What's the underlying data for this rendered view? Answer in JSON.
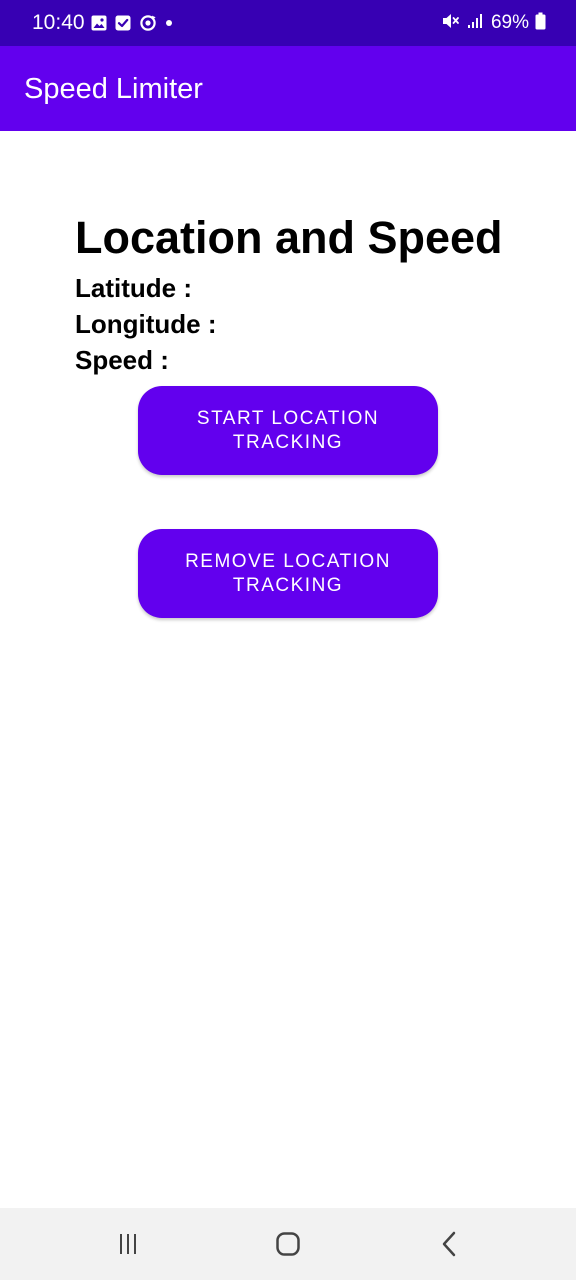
{
  "status_bar": {
    "time": "10:40",
    "left_icons": [
      "gallery-icon",
      "checkbox-icon",
      "sync-icon",
      "dot-icon"
    ],
    "right_icons": [
      "mute-vibrate-icon",
      "signal-icon",
      "battery-icon"
    ],
    "battery_percent": "69%",
    "background_color": "#3700b3"
  },
  "app_bar": {
    "title": "Speed Limiter",
    "background_color": "#6200ee"
  },
  "main": {
    "heading": "Location and Speed",
    "latitude_label": "Latitude :",
    "longitude_label": "Longitude :",
    "speed_label": "Speed :",
    "start_button_label": "START LOCATION\nTRACKING",
    "remove_button_label": "REMOVE LOCATION\nTRACKING",
    "button_color": "#6200ee"
  },
  "nav_bar": {
    "icons": [
      "recents-icon",
      "home-icon",
      "back-icon"
    ]
  }
}
